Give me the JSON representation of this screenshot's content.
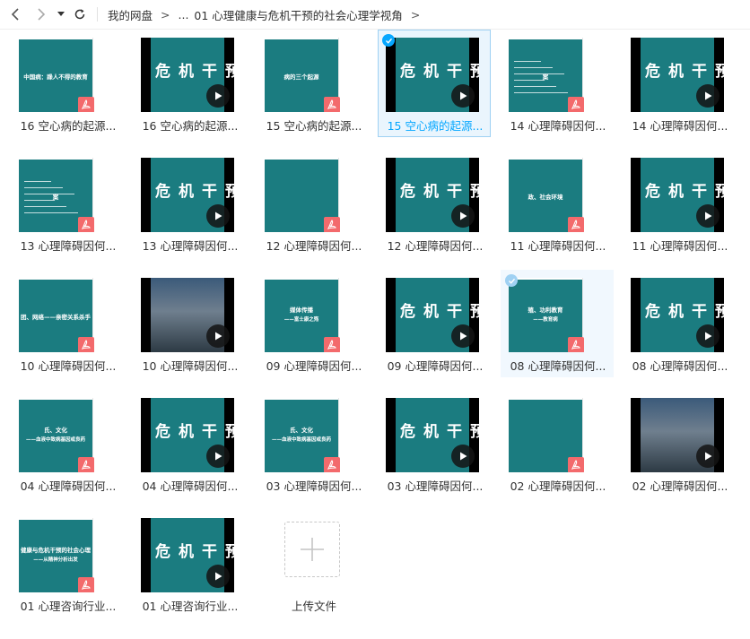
{
  "toolbar": {
    "back_icon": "chevron-left-icon",
    "forward_icon": "chevron-right-icon",
    "dropdown_icon": "caret-down-icon",
    "refresh_icon": "refresh-icon"
  },
  "breadcrumb": {
    "root": "我的网盘",
    "ellipsis": "...",
    "current": "01 心理健康与危机干预的社会心理学视角",
    "separator": ">"
  },
  "colors": {
    "accent": "#06a7ff",
    "slide_teal": "#1b7c80",
    "pdf_red": "#f36a6c",
    "selected_bg": "#eaf5fd"
  },
  "video_thumb_text": "危机干预",
  "files": [
    {
      "name": "16 空心病的起源...",
      "type": "pdf",
      "thumb": "16 空心病 slide",
      "slide_text": "中国病：躁人不得的教育"
    },
    {
      "name": "16 空心病的起源...",
      "type": "video"
    },
    {
      "name": "15 空心病的起源...",
      "type": "pdf",
      "slide_text": "病的三个起源"
    },
    {
      "name": "15 空心病的起源...",
      "type": "video",
      "state": "selected"
    },
    {
      "name": "14 心理障碍因何...",
      "type": "pdf",
      "slide_text": "案"
    },
    {
      "name": "14 心理障碍因何...",
      "type": "video"
    },
    {
      "name": "13 心理障碍因何...",
      "type": "pdf",
      "slide_text": "案"
    },
    {
      "name": "13 心理障碍因何...",
      "type": "video"
    },
    {
      "name": "12 心理障碍因何...",
      "type": "pdf",
      "slide_text": ""
    },
    {
      "name": "12 心理障碍因何...",
      "type": "video"
    },
    {
      "name": "11 心理障碍因何...",
      "type": "pdf",
      "slide_text": "政、社会环境"
    },
    {
      "name": "11 心理障碍因何...",
      "type": "video"
    },
    {
      "name": "10 心理障碍因何...",
      "type": "pdf",
      "slide_text": "团、网络——亲密关系杀手"
    },
    {
      "name": "10 心理障碍因何...",
      "type": "video",
      "variant": "photo"
    },
    {
      "name": "09 心理障碍因何...",
      "type": "pdf",
      "slide_text": "媒体传播",
      "slide_sub": "——富士康之殇"
    },
    {
      "name": "09 心理障碍因何...",
      "type": "video"
    },
    {
      "name": "08 心理障碍因何...",
      "type": "pdf",
      "state": "hover",
      "slide_text": "殖、功利教育",
      "slide_sub": "——教育病"
    },
    {
      "name": "08 心理障碍因何...",
      "type": "video"
    },
    {
      "name": "04 心理障碍因何...",
      "type": "pdf",
      "slide_text": "氏、文化",
      "slide_sub": "——血液中致病基因或良药"
    },
    {
      "name": "04 心理障碍因何...",
      "type": "video"
    },
    {
      "name": "03 心理障碍因何...",
      "type": "pdf",
      "slide_text": "氏、文化",
      "slide_sub": "——血液中致病基因或良药"
    },
    {
      "name": "03 心理障碍因何...",
      "type": "video"
    },
    {
      "name": "02 心理障碍因何...",
      "type": "pdf",
      "slide_text": ""
    },
    {
      "name": "02 心理障碍因何...",
      "type": "video",
      "variant": "photo"
    },
    {
      "name": "01 心理咨询行业...",
      "type": "pdf",
      "slide_text": "健康与危机干预的社会心理",
      "slide_sub": "——从精神分析出发"
    },
    {
      "name": "01 心理咨询行业...",
      "type": "video"
    },
    {
      "name": "上传文件",
      "type": "upload"
    }
  ]
}
